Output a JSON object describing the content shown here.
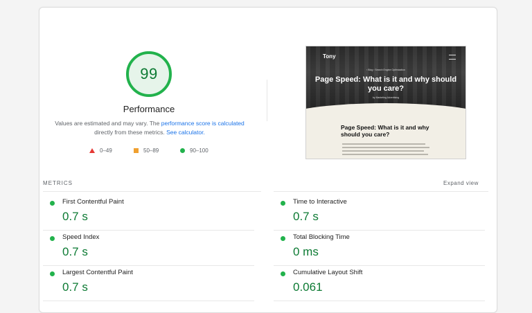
{
  "summary": {
    "score": "99",
    "category": "Performance",
    "desc_text1": "Values are estimated and may vary. The ",
    "desc_link1": "performance score is calculated",
    "desc_text2": " directly from these metrics. ",
    "desc_link2": "See calculator.",
    "score_fraction": 0.99,
    "score_color": "#0c7a33",
    "ring_color": "#22b24c"
  },
  "legend": [
    {
      "label": "0–49",
      "icon": "triangle-icon",
      "color": "#e53935"
    },
    {
      "label": "50–89",
      "icon": "square-icon",
      "color": "#f0a030"
    },
    {
      "label": "90–100",
      "icon": "circle-icon",
      "color": "#22b24c"
    }
  ],
  "screenshot": {
    "logo": "Tony",
    "breadcrumb": "› Blog › Search Engine Optimization",
    "hero_title": "Page Speed: What is it and why should you care?",
    "author": "by Marketing Advertising",
    "body_title": "Page Speed: What is it and why should you care?"
  },
  "metrics": {
    "header": "METRICS",
    "expand_label": "Expand view",
    "items": [
      {
        "name": "First Contentful Paint",
        "value": "0.7 s"
      },
      {
        "name": "Time to Interactive",
        "value": "0.7 s"
      },
      {
        "name": "Speed Index",
        "value": "0.7 s"
      },
      {
        "name": "Total Blocking Time",
        "value": "0 ms"
      },
      {
        "name": "Largest Contentful Paint",
        "value": "0.7 s"
      },
      {
        "name": "Cumulative Layout Shift",
        "value": "0.061"
      }
    ]
  }
}
